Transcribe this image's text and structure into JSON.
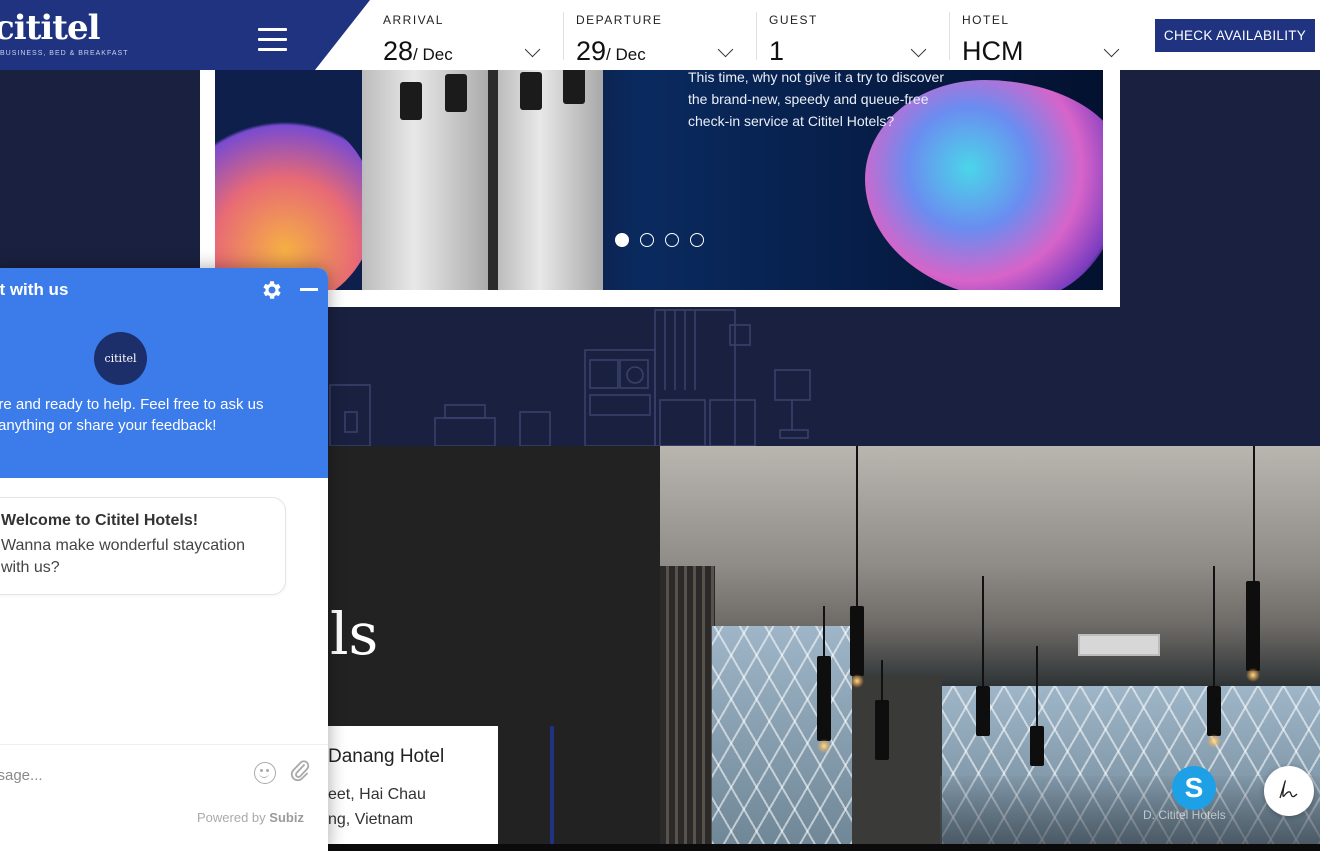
{
  "brand": {
    "logo": "cititel",
    "tagline": "BUSINESS, BED & BREAKFAST"
  },
  "booking": {
    "arrival": {
      "label": "ARRIVAL",
      "day": "28",
      "month": "/ Dec"
    },
    "departure": {
      "label": "DEPARTURE",
      "day": "29",
      "month": "/ Dec"
    },
    "guest": {
      "label": "GUEST",
      "value": "1"
    },
    "hotel": {
      "label": "HOTEL",
      "value": "HCM"
    },
    "check_label": "CHECK AVAILABILITY"
  },
  "hero": {
    "text_lines": [
      "This time, why not give it a try to discover",
      "the brand-new, speedy and queue-free",
      "check-in service at Cititel Hotels?"
    ],
    "slides_total": 4,
    "active_slide": 1
  },
  "section": {
    "heading_partial": "ls",
    "hotel_name": "Danang Hotel",
    "address_line1": "eet, Hai Chau",
    "address_line2": "ng, Vietnam",
    "photo_caption": "D. Cititel Hotels"
  },
  "chat": {
    "title": "at with us",
    "avatar_text": "cititel",
    "intro_line1": "ere and ready to help. Feel free to ask us",
    "intro_line2": "anything or share your feedback!",
    "bubble_title": "Welcome to Cititel Hotels!",
    "bubble_line1": "Wanna make wonderful staycation",
    "bubble_line2": "with us?",
    "input_placeholder": "ssage...",
    "powered_prefix": "Powered by",
    "powered_brand": "Subiz"
  },
  "widgets": {
    "skype_letter": "S"
  },
  "colors": {
    "brand_blue": "#1f3380",
    "chat_blue": "#3b7bea",
    "skype_blue": "#1ea0e6",
    "page_navy": "#1a2140"
  },
  "icons": [
    "hamburger-icon",
    "chevron-down-icon",
    "gear-icon",
    "minimize-icon",
    "emoji-icon",
    "paperclip-icon",
    "skype-icon",
    "signature-icon"
  ]
}
